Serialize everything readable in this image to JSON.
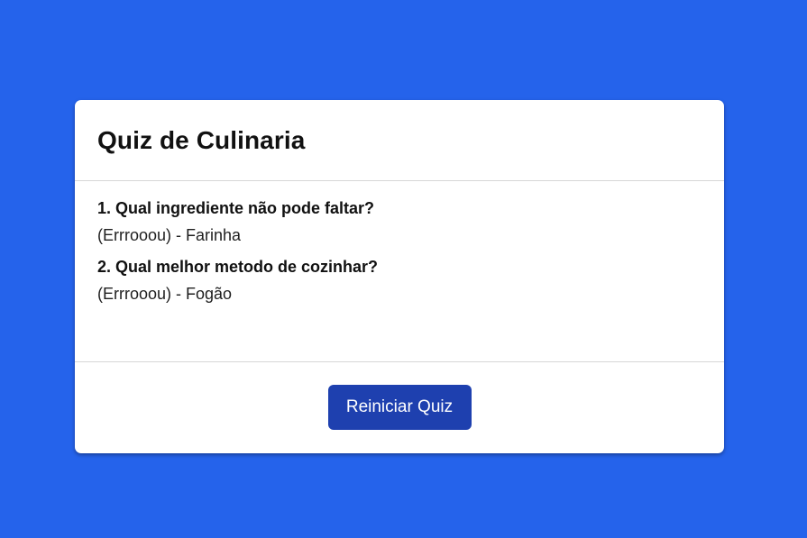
{
  "quiz": {
    "title": "Quiz de Culinaria",
    "questions": [
      {
        "question": "1. Qual ingrediente não pode faltar?",
        "answer": "(Errrooou) - Farinha"
      },
      {
        "question": "2. Qual melhor metodo de cozinhar?",
        "answer": "(Errrooou) - Fogão"
      }
    ],
    "restart_label": "Reiniciar Quiz"
  },
  "colors": {
    "background": "#2563eb",
    "card": "#ffffff",
    "button": "#1e40af",
    "button_text": "#ffffff"
  }
}
